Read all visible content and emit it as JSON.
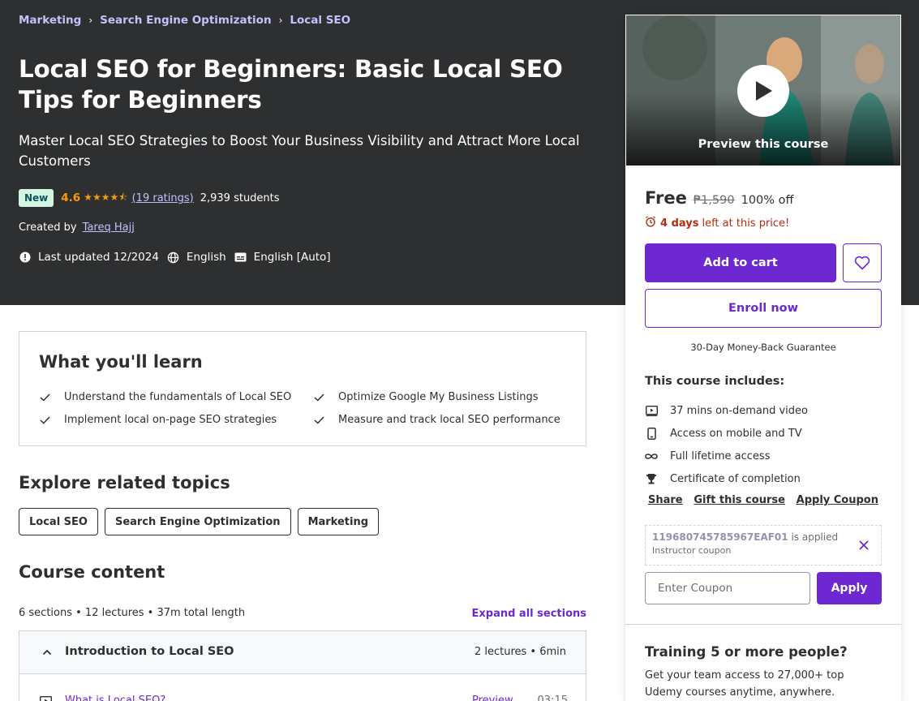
{
  "breadcrumb": [
    "Marketing",
    "Search Engine Optimization",
    "Local SEO"
  ],
  "course": {
    "title": "Local SEO for Beginners: Basic Local SEO Tips for Beginners",
    "subtitle": "Master Local SEO Strategies to Boost Your Business Visibility and Attract More Local Customers",
    "badge": "New",
    "rating": "4.6",
    "rating_value": 4.6,
    "ratings_link": "(19 ratings)",
    "students": "2,939 students",
    "created_by_label": "Created by",
    "instructor": "Tareq Hajj",
    "last_updated": "Last updated 12/2024",
    "language": "English",
    "captions": "English [Auto]"
  },
  "sidebar": {
    "preview_label": "Preview this course",
    "price": "Free",
    "original_price": "₱1,590",
    "discount": "100% off",
    "timer_days": "4 days",
    "timer_suffix": "left at this price!",
    "add_to_cart": "Add to cart",
    "enroll_now": "Enroll now",
    "guarantee": "30-Day Money-Back Guarantee",
    "includes_title": "This course includes:",
    "includes": [
      {
        "icon": "video-icon",
        "label": "37 mins on-demand video"
      },
      {
        "icon": "mobile-icon",
        "label": "Access on mobile and TV"
      },
      {
        "icon": "infinity-icon",
        "label": "Full lifetime access"
      },
      {
        "icon": "trophy-icon",
        "label": "Certificate of completion"
      }
    ],
    "links": [
      "Share",
      "Gift this course",
      "Apply Coupon"
    ],
    "coupon_code": "119680745785967EAF01",
    "coupon_applied": "is applied",
    "coupon_type": "Instructor coupon",
    "coupon_placeholder": "Enter Coupon",
    "apply": "Apply",
    "training_title": "Training 5 or more people?",
    "training_text": "Get your team access to 27,000+ top Udemy courses anytime, anywhere."
  },
  "learn": {
    "title": "What you'll learn",
    "items": [
      "Understand the fundamentals of Local SEO",
      "Optimize Google My Business Listings",
      "Implement local on-page SEO strategies",
      "Measure and track local SEO performance"
    ]
  },
  "related": {
    "title": "Explore related topics",
    "topics": [
      "Local SEO",
      "Search Engine Optimization",
      "Marketing"
    ]
  },
  "content": {
    "title": "Course content",
    "meta": "6 sections • 12 lectures • 37m total length",
    "expand_all": "Expand all sections",
    "sections": [
      {
        "title": "Introduction to Local SEO",
        "meta": "2 lectures • 6min",
        "lectures": [
          {
            "title": "What is Local SEO?",
            "preview": "Preview",
            "duration": "03:15"
          }
        ]
      }
    ]
  },
  "colors": {
    "hero_bg": "#2d2f31",
    "accent": "#6d28d2",
    "link_light": "#c0c4fc",
    "star": "#f69c08",
    "urgency": "#b32d0f",
    "badge_bg": "#d2f6e1"
  }
}
